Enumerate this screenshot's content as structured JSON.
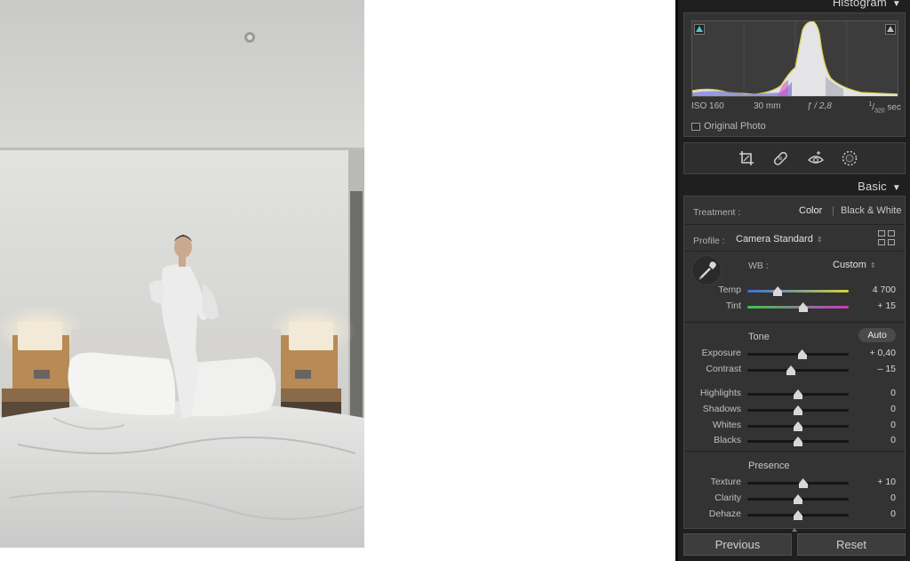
{
  "histogram": {
    "title": "Histogram",
    "iso": "ISO 160",
    "focal": "30 mm",
    "aperture": "ƒ / 2,8",
    "shutter_num": "1",
    "shutter_den": "320",
    "shutter_unit": " sec",
    "original_photo_label": "Original Photo"
  },
  "tools": [
    "crop-icon",
    "healing-icon",
    "red-eye-icon",
    "masking-icon"
  ],
  "basic": {
    "title": "Basic",
    "treatment_label": "Treatment :",
    "treatment_color": "Color",
    "treatment_bw": "Black & White",
    "profile_label": "Profile :",
    "profile_value": "Camera Standard",
    "wb_label": "WB :",
    "wb_value": "Custom",
    "tone_label": "Tone",
    "auto_label": "Auto",
    "presence_label": "Presence",
    "sliders": {
      "temp": {
        "label": "Temp",
        "value": "4 700",
        "pos": 0.3
      },
      "tint": {
        "label": "Tint",
        "value": "+ 15",
        "pos": 0.55
      },
      "exposure": {
        "label": "Exposure",
        "value": "+ 0,40",
        "pos": 0.54
      },
      "contrast": {
        "label": "Contrast",
        "value": "– 15",
        "pos": 0.43
      },
      "highlights": {
        "label": "Highlights",
        "value": "0",
        "pos": 0.5
      },
      "shadows": {
        "label": "Shadows",
        "value": "0",
        "pos": 0.5
      },
      "whites": {
        "label": "Whites",
        "value": "0",
        "pos": 0.5
      },
      "blacks": {
        "label": "Blacks",
        "value": "0",
        "pos": 0.5
      },
      "texture": {
        "label": "Texture",
        "value": "+ 10",
        "pos": 0.55
      },
      "clarity": {
        "label": "Clarity",
        "value": "0",
        "pos": 0.5
      },
      "dehaze": {
        "label": "Dehaze",
        "value": "0",
        "pos": 0.5
      }
    }
  },
  "buttons": {
    "previous": "Previous",
    "reset": "Reset"
  },
  "colors": {
    "panel_bg": "#1f1f1f",
    "section_bg": "#333333",
    "temp_gradient": [
      "#3a6fd6",
      "#d6d23a"
    ],
    "tint_gradient": [
      "#3ac94a",
      "#c93ac6"
    ],
    "clip_shadow": "#49c5d6"
  }
}
